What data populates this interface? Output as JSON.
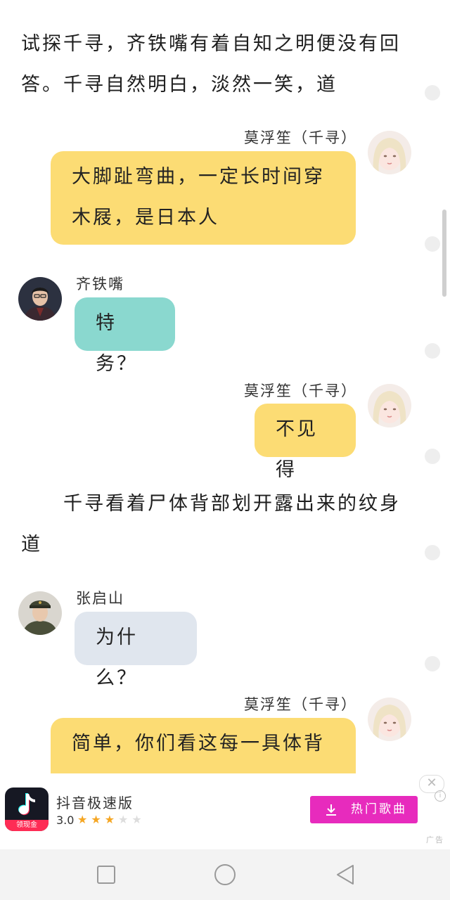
{
  "narration": {
    "p1": "试探千寻，齐铁嘴有着自知之明便没有回答。千寻自然明白，淡然一笑，道",
    "p2": "千寻看着尸体背部划开露出来的纹身道"
  },
  "messages": [
    {
      "sender": "莫浮笙（千寻）",
      "text": "大脚趾弯曲，一定长时间穿木屐，是日本人",
      "color": "#fcdc74"
    },
    {
      "sender": "齐铁嘴",
      "text": "特务？",
      "color": "#8ad8cf"
    },
    {
      "sender": "莫浮笙（千寻）",
      "text": "不见得",
      "color": "#fcdc74"
    },
    {
      "sender": "张启山",
      "text": "为什么？",
      "color": "#e0e6ee"
    },
    {
      "sender": "莫浮笙（千寻）",
      "text": "简单，你们看这每一具体背",
      "color": "#fcdc74"
    }
  ],
  "ad": {
    "app_name": "抖音极速版",
    "rating": "3.0",
    "stars_filled": 3,
    "stars_total": 5,
    "icon_badge": "领现金",
    "button_label": "热门歌曲",
    "ad_mark": "广告",
    "close_symbol": "✕",
    "info_symbol": "i"
  },
  "nav": {
    "icons": [
      "recent-apps-icon",
      "home-icon",
      "back-icon"
    ]
  },
  "colors": {
    "yellow_bubble": "#fcdc74",
    "teal_bubble": "#8ad8cf",
    "gray_bubble": "#e0e6ee",
    "ad_button": "#e72bbd"
  }
}
